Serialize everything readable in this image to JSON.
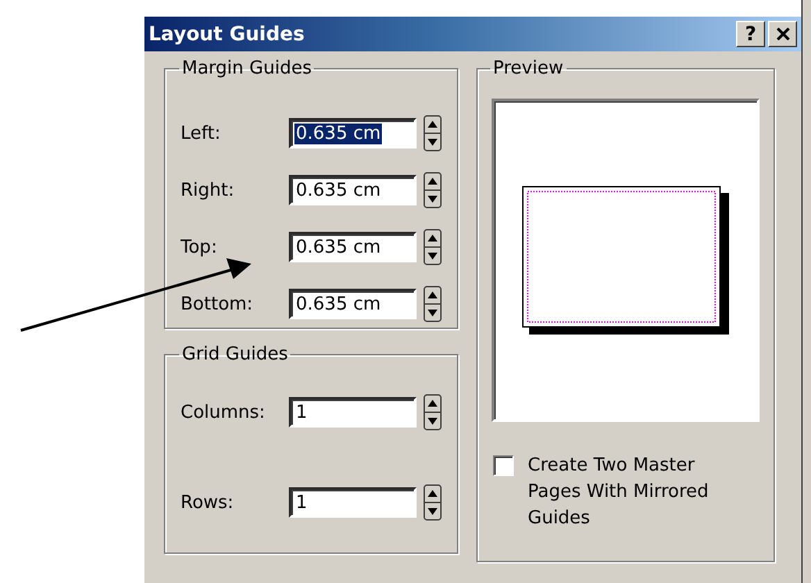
{
  "window": {
    "title": "Layout Guides",
    "help_button": "?"
  },
  "margin_guides": {
    "title": "Margin Guides",
    "fields": [
      {
        "label": "Left:",
        "value": "0.635 cm",
        "selected": true
      },
      {
        "label": "Right:",
        "value": "0.635 cm",
        "selected": false
      },
      {
        "label": "Top:",
        "value": "0.635 cm",
        "selected": false
      },
      {
        "label": "Bottom:",
        "value": "0.635 cm",
        "selected": false
      }
    ]
  },
  "grid_guides": {
    "title": "Grid Guides",
    "fields": [
      {
        "label": "Columns:",
        "value": "1",
        "selected": false
      },
      {
        "label": "Rows:",
        "value": "1",
        "selected": false
      }
    ]
  },
  "preview": {
    "title": "Preview"
  },
  "mirrored_option": {
    "label": "Create Two Master Pages With Mirrored Guides",
    "checked": false
  }
}
